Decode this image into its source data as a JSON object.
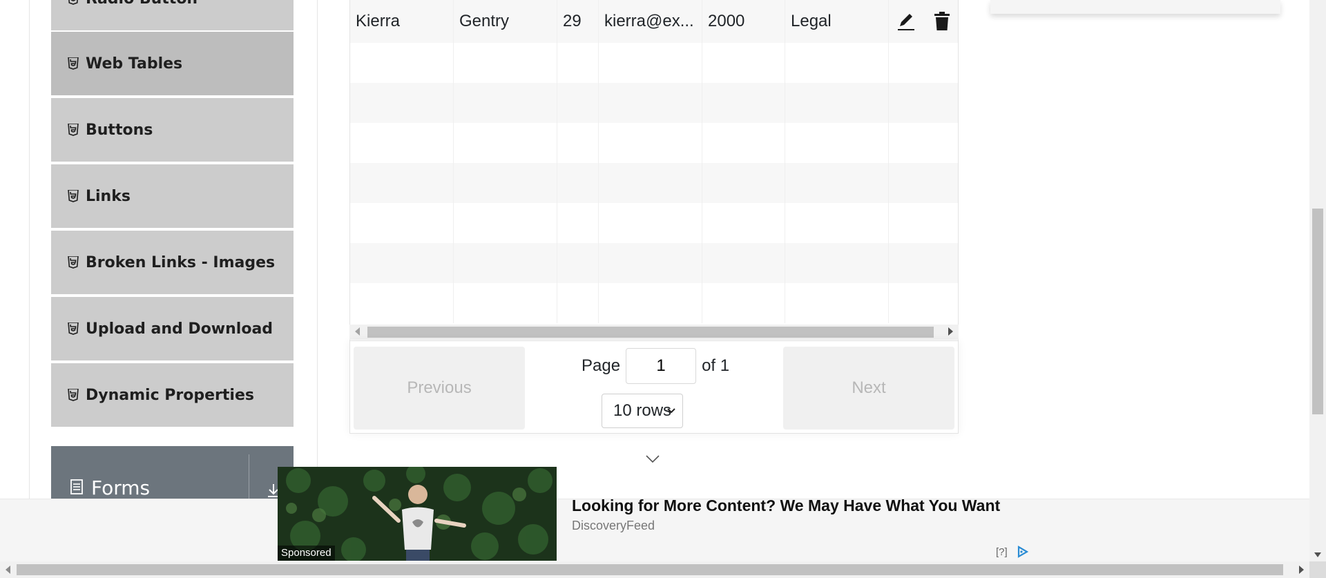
{
  "sidebar": {
    "items": [
      {
        "label": "Radio Button",
        "icon": "html5-icon"
      },
      {
        "label": "Web Tables",
        "icon": "html5-icon",
        "active": true
      },
      {
        "label": "Buttons",
        "icon": "html5-icon"
      },
      {
        "label": "Links",
        "icon": "html5-icon"
      },
      {
        "label": "Broken Links - Images",
        "icon": "html5-icon"
      },
      {
        "label": "Upload and Download",
        "icon": "html5-icon"
      },
      {
        "label": "Dynamic Properties",
        "icon": "html5-icon"
      }
    ],
    "group": {
      "title": "Forms",
      "icon": "document-icon",
      "toggle_icon": "download-arrow-icon"
    }
  },
  "table": {
    "rows": [
      {
        "first_name": "Kierra",
        "last_name": "Gentry",
        "age": "29",
        "email": "kierra@ex...",
        "salary": "2000",
        "department": "Legal"
      }
    ],
    "empty_rows": 7,
    "actions": {
      "edit_icon": "pencil-icon",
      "delete_icon": "trash-icon"
    }
  },
  "pagination": {
    "previous_label": "Previous",
    "next_label": "Next",
    "page_label": "Page",
    "current_page": "1",
    "of_label": "of 1",
    "rows_selected": "10 rows"
  },
  "ad": {
    "title": "Looking for More Content? We May Have What You Want",
    "source": "DiscoveryFeed",
    "sponsored": "Sponsored",
    "help": "[?]"
  },
  "colors": {
    "sidebar_item_bg": "#cccccc",
    "sidebar_active_bg": "#bdbdbd",
    "group_header_bg": "#6c757d",
    "disabled_button_text": "#b7b7b7",
    "ad_logo": "#2a8cd4"
  }
}
